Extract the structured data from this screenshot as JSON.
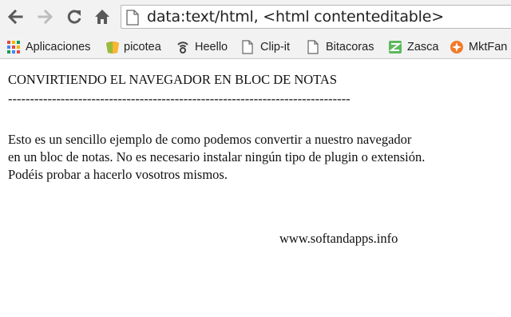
{
  "browser": {
    "address": "data:text/html, <html contenteditable>"
  },
  "bookmarks": [
    {
      "label": "Aplicaciones",
      "icon": "apps-grid-icon"
    },
    {
      "label": "picotea",
      "icon": "picotea-icon"
    },
    {
      "label": "Heello",
      "icon": "heello-icon"
    },
    {
      "label": "Clip-it",
      "icon": "page-icon"
    },
    {
      "label": "Bitacoras",
      "icon": "page-icon"
    },
    {
      "label": "Zasca",
      "icon": "zasca-icon"
    },
    {
      "label": "MktFan",
      "icon": "mktfan-icon"
    }
  ],
  "document": {
    "title": "CONVIRTIENDO EL NAVEGADOR EN BLOC DE NOTAS",
    "rule": "------------------------------------------------------------------------------",
    "paragraph_lines": [
      "Esto es un sencillo ejemplo de como podemos convertir a nuestro navegador",
      "en un bloc de notas. No es necesario instalar ningún tipo de plugin o extensión.",
      "Podéis probar a hacerlo vosotros mismos."
    ],
    "signature": "www.softandapps.info"
  },
  "colors": {
    "chrome": "#f2f2f2",
    "icon_dark": "#5a5a5a",
    "icon_disabled": "#bdbdbd"
  }
}
